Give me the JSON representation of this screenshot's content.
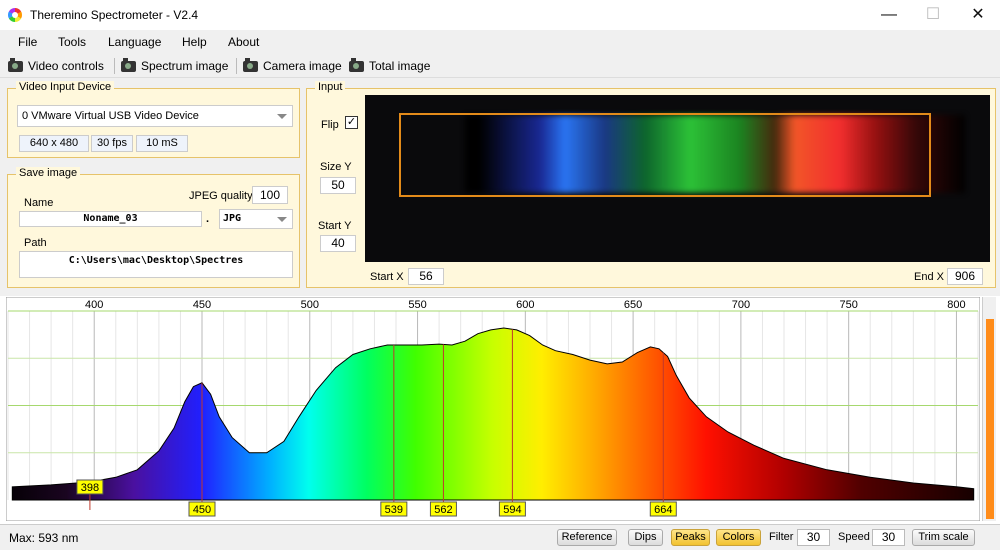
{
  "window": {
    "title": "Theremino Spectrometer - V2.4",
    "minimize": "—",
    "maximize": "☐",
    "close": "✕"
  },
  "menu": [
    "File",
    "Tools",
    "Language",
    "Help",
    "About"
  ],
  "toolbar": {
    "video_controls": "Video controls",
    "spectrum_image": "Spectrum image",
    "camera_image": "Camera image",
    "total_image": "Total image"
  },
  "video_input": {
    "title": "Video Input Device",
    "device": "0 VMware Virtual USB Video Device",
    "resolution": "640 x 480",
    "fps": "30 fps",
    "exposure": "10 mS"
  },
  "save_image": {
    "title": "Save image",
    "name_label": "Name",
    "jpeg_quality_label": "JPEG quality",
    "jpeg_quality": "100",
    "name": "Noname_03",
    "dot": ".",
    "format": "JPG",
    "path_label": "Path",
    "path": "C:\\Users\\mac\\Desktop\\Spectres"
  },
  "input": {
    "title": "Input",
    "flip_label": "Flip",
    "flip_checked": "✓",
    "size_y_label": "Size Y",
    "size_y": "50",
    "start_y_label": "Start Y",
    "start_y": "40",
    "start_x_label": "Start X",
    "start_x": "56",
    "end_x_label": "End X",
    "end_x": "906"
  },
  "chart_data": {
    "type": "area",
    "xlim": [
      360,
      810
    ],
    "ylim": [
      0,
      100
    ],
    "x_ticks": [
      400,
      450,
      500,
      550,
      600,
      650,
      700,
      750,
      800
    ],
    "series": [
      {
        "x": [
          362,
          380,
          398,
          410,
          420,
          430,
          437,
          442,
          446,
          450,
          454,
          458,
          464,
          472,
          480,
          488,
          495,
          503,
          512,
          520,
          528,
          536,
          545,
          552,
          560,
          566,
          572,
          578,
          584,
          590,
          596,
          602,
          608,
          614,
          622,
          630,
          638,
          645,
          652,
          658,
          662,
          666,
          670,
          676,
          684,
          694,
          706,
          720,
          740,
          760,
          780,
          800,
          808
        ],
        "y": [
          7,
          8,
          9.5,
          12,
          16,
          26,
          38,
          52,
          60,
          62,
          56,
          44,
          33,
          25,
          25,
          31,
          44,
          58,
          70,
          77,
          80,
          82,
          82,
          82,
          82.5,
          82,
          84,
          88,
          90,
          91,
          90,
          87,
          82,
          79,
          77,
          74,
          72,
          73,
          78,
          81,
          80,
          76,
          66,
          54,
          44,
          36,
          29,
          22,
          16,
          12,
          9,
          7,
          6
        ]
      }
    ],
    "peaks": [
      {
        "x": 398,
        "label": "398"
      },
      {
        "x": 450,
        "label": "450"
      },
      {
        "x": 539,
        "label": "539"
      },
      {
        "x": 562,
        "label": "562"
      },
      {
        "x": 594,
        "label": "594"
      },
      {
        "x": 664,
        "label": "664"
      }
    ],
    "grid": true
  },
  "status": {
    "max": "Max: 593 nm",
    "reference": "Reference",
    "dips": "Dips",
    "peaks": "Peaks",
    "colors": "Colors",
    "filter_label": "Filter",
    "filter": "30",
    "speed_label": "Speed",
    "speed": "30",
    "trim_scale": "Trim scale"
  }
}
